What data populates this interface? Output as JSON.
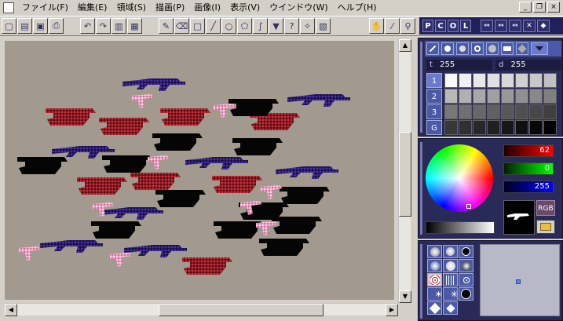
{
  "menubar": {
    "items": [
      "ファイル(F)",
      "編集(E)",
      "領域(S)",
      "描画(P)",
      "画像(I)",
      "表示(V)",
      "ウインドウ(W)",
      "ヘルプ(H)"
    ]
  },
  "window_controls": {
    "minimize": "_",
    "restore": "❐",
    "close": "×"
  },
  "toolbar": {
    "file_buttons": [
      "new-icon",
      "open-icon",
      "save-icon",
      "print-icon"
    ],
    "edit_buttons": [
      "undo-icon",
      "redo-icon",
      "copy-icon",
      "paste-icon"
    ],
    "tool_buttons": [
      "pen-icon",
      "eraser-icon",
      "rect-icon",
      "line-icon",
      "ellipse-icon",
      "polygon-icon",
      "curve-icon",
      "fill-icon",
      "lasso-icon",
      "magic-wand-icon",
      "text-icon"
    ],
    "view_buttons": [
      "hand-icon",
      "eyedropper-icon",
      "zoom-icon"
    ]
  },
  "pcol_bar": {
    "letters": [
      "P",
      "C",
      "O",
      "L"
    ],
    "buttons": [
      "⇔",
      "⇔",
      "⇔",
      "✕",
      "◆"
    ]
  },
  "pen_panel": {
    "thickness_label": "t",
    "thickness_value": "255",
    "density_label": "d",
    "density_value": "255",
    "tabs": [
      "1",
      "2",
      "3",
      "G"
    ]
  },
  "color_panel": {
    "red_value": "62",
    "green_value": "0",
    "blue_value": "255",
    "mode_label": "RGB",
    "colors": {
      "red": "#ff0000",
      "green": "#00ff00",
      "blue": "#0000ff"
    }
  },
  "canvas": {
    "background": "#a29a8e"
  }
}
